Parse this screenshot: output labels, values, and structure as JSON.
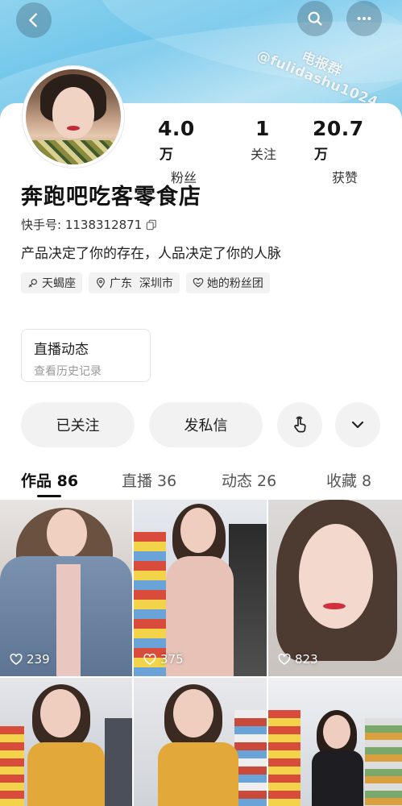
{
  "watermark": {
    "line1": "电报群",
    "line2": "@fulidashu1024"
  },
  "profile": {
    "name": "奔跑吧吃客零食店",
    "kuaishou_id": "快手号: 1138312871",
    "bio": "产品决定了你的存在，人品决定了你的人脉"
  },
  "stats": [
    {
      "value": "4.0",
      "unit": "万",
      "label": "粉丝"
    },
    {
      "value": "1",
      "unit": "",
      "label": "关注"
    },
    {
      "value": "20.7",
      "unit": "万",
      "label": "获赞"
    }
  ],
  "tags": [
    {
      "label": "天蝎座",
      "icon": "scorpio-icon"
    },
    {
      "label": "广东  深圳市",
      "icon": "location-icon"
    },
    {
      "label": "她的粉丝团",
      "icon": "fan-group-icon"
    }
  ],
  "live_card": {
    "title": "直播动态",
    "subtitle": "查看历史记录"
  },
  "actions": {
    "followed": "已关注",
    "message": "发私信"
  },
  "tabs": [
    {
      "label": "作品 86",
      "active": true
    },
    {
      "label": "直播 36",
      "active": false
    },
    {
      "label": "动态 26",
      "active": false
    },
    {
      "label": "收藏 8",
      "active": false
    }
  ],
  "videos": [
    {
      "likes": "239"
    },
    {
      "likes": "375"
    },
    {
      "likes": "823"
    },
    {
      "likes": ""
    },
    {
      "likes": ""
    },
    {
      "likes": ""
    }
  ],
  "colors": {
    "banner": "#6cc4ea",
    "chip_bg": "#f2f2f2",
    "text": "#1a1a1a"
  }
}
